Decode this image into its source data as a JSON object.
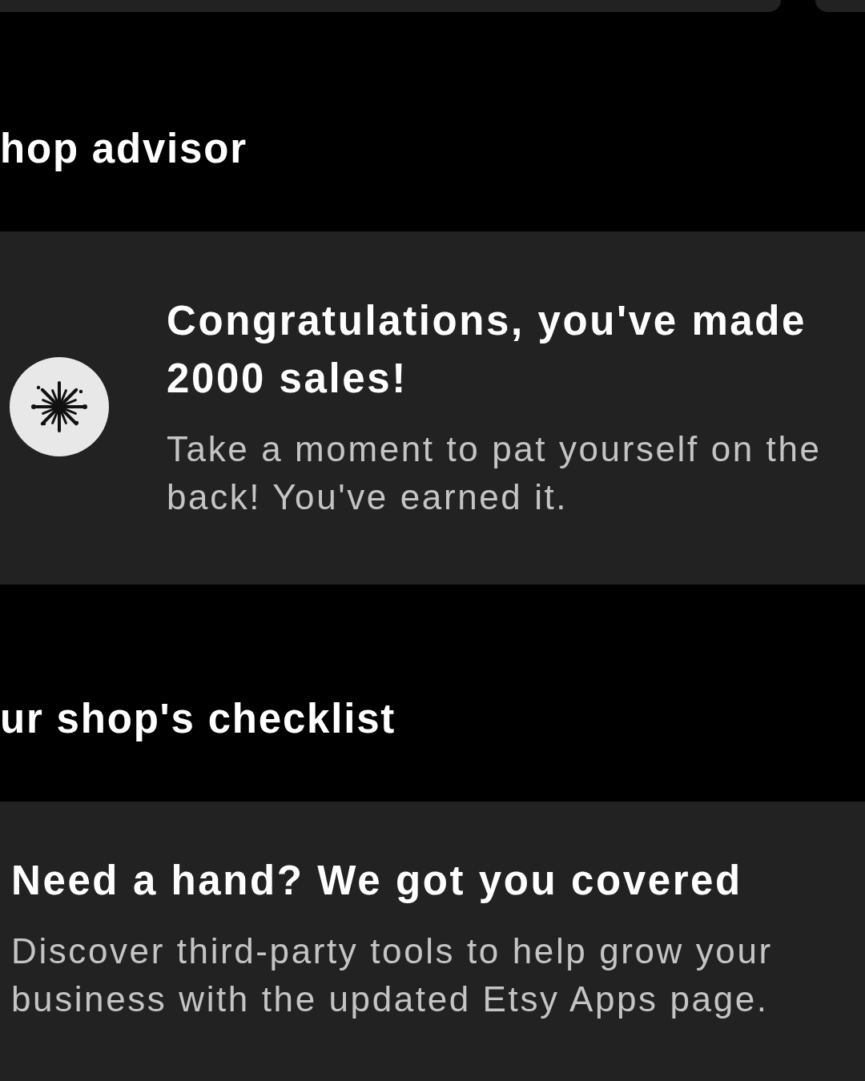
{
  "sections": [
    {
      "heading": "hop advisor",
      "card": {
        "kind": "milestone",
        "title": "Congratulations, you've made 2000 sales!",
        "body": "Take a moment to pat yourself on the back! You've earned it."
      }
    },
    {
      "heading": "ur shop's checklist",
      "card": {
        "kind": "promo",
        "title": "Need a hand? We got you covered",
        "body": "Discover third-party tools to help grow your business with the updated Etsy Apps page."
      }
    }
  ]
}
